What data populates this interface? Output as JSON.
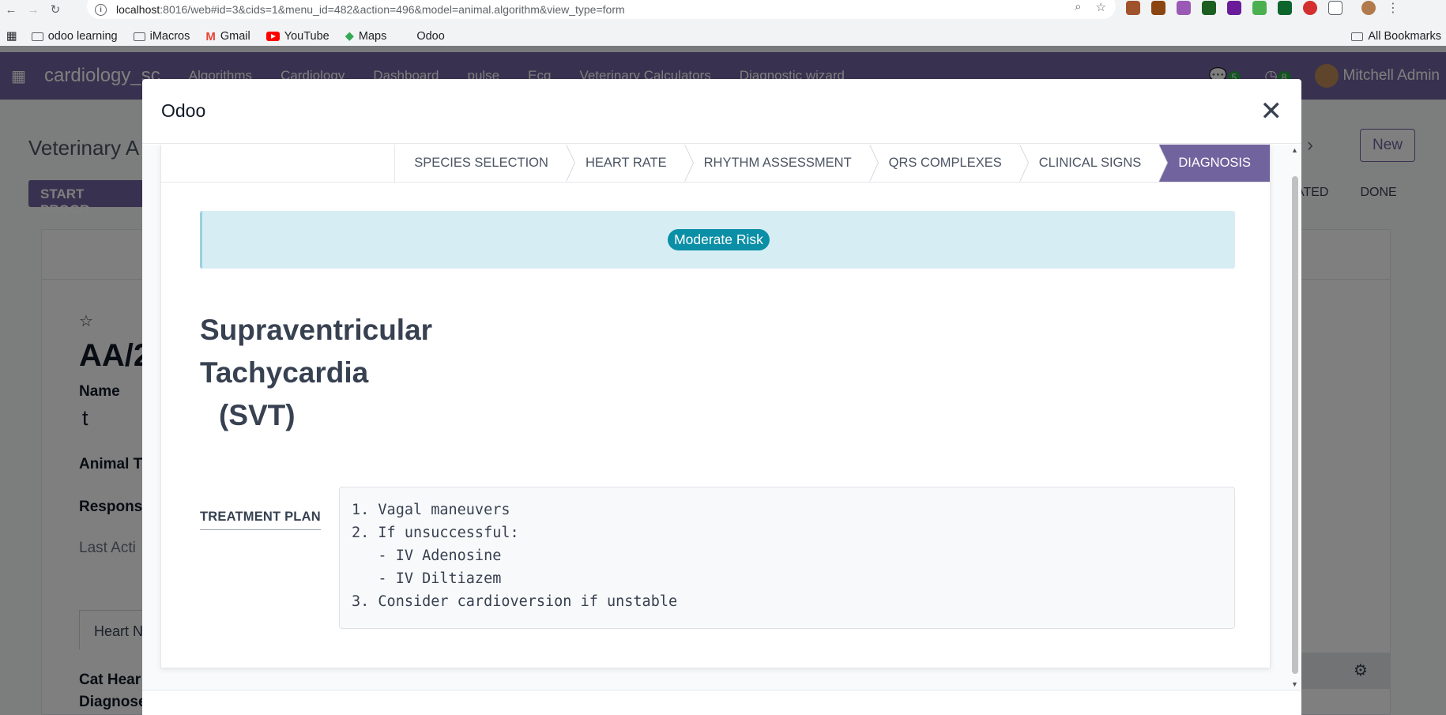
{
  "browser": {
    "url_host": "localhost",
    "url_rest": ":8016/web#id=3&cids=1&menu_id=482&action=496&model=animal.algorithm&view_type=form",
    "bookmarks": [
      "odoo learning",
      "iMacros",
      "Gmail",
      "YouTube",
      "Maps",
      "Odoo"
    ],
    "all_bookmarks": "All Bookmarks"
  },
  "app": {
    "brand": "cardiology_sc",
    "menus": [
      "Algorithms",
      "Cardiology",
      "Dashboard",
      "pulse",
      "Ecg",
      "Veterinary Calculators",
      "Diagnostic wizard"
    ],
    "messages_count": "5",
    "activities_count": "8",
    "user": "Mitchell Admin",
    "breadcrumb": "Veterinary A",
    "start_button": "START PROGR",
    "new_button": "New",
    "status_partial": [
      "ATED",
      "DONE"
    ],
    "record_ref": "AA/2",
    "name_label": "Name",
    "name_value": "t",
    "animal_type_label": "Animal T",
    "responsible_label": "Respons",
    "last_activity_label": "Last Acti",
    "tab_label": "Heart N",
    "cat_heart_label": "Cat Hear",
    "diagnose_label": "Diagnose"
  },
  "modal": {
    "title": "Odoo",
    "steps": [
      {
        "label": "SPECIES SELECTION",
        "active": false
      },
      {
        "label": "HEART RATE",
        "active": false
      },
      {
        "label": "RHYTHM ASSESSMENT",
        "active": false
      },
      {
        "label": "QRS COMPLEXES",
        "active": false
      },
      {
        "label": "CLINICAL SIGNS",
        "active": false
      },
      {
        "label": "DIAGNOSIS",
        "active": true
      }
    ],
    "risk_badge": "Moderate Risk",
    "diagnosis_line1": "Supraventricular",
    "diagnosis_line2": "Tachycardia",
    "diagnosis_line3": "(SVT)",
    "treatment_label": "TREATMENT PLAN",
    "treatment_plan": "1. Vagal maneuvers\n2. If unsuccessful:\n   - IV Adenosine\n   - IV Diltiazem\n3. Consider cardioversion if unstable"
  },
  "colors": {
    "brand": "#71639e",
    "info_bg": "#d6eef3",
    "badge": "#0b8fa6"
  }
}
